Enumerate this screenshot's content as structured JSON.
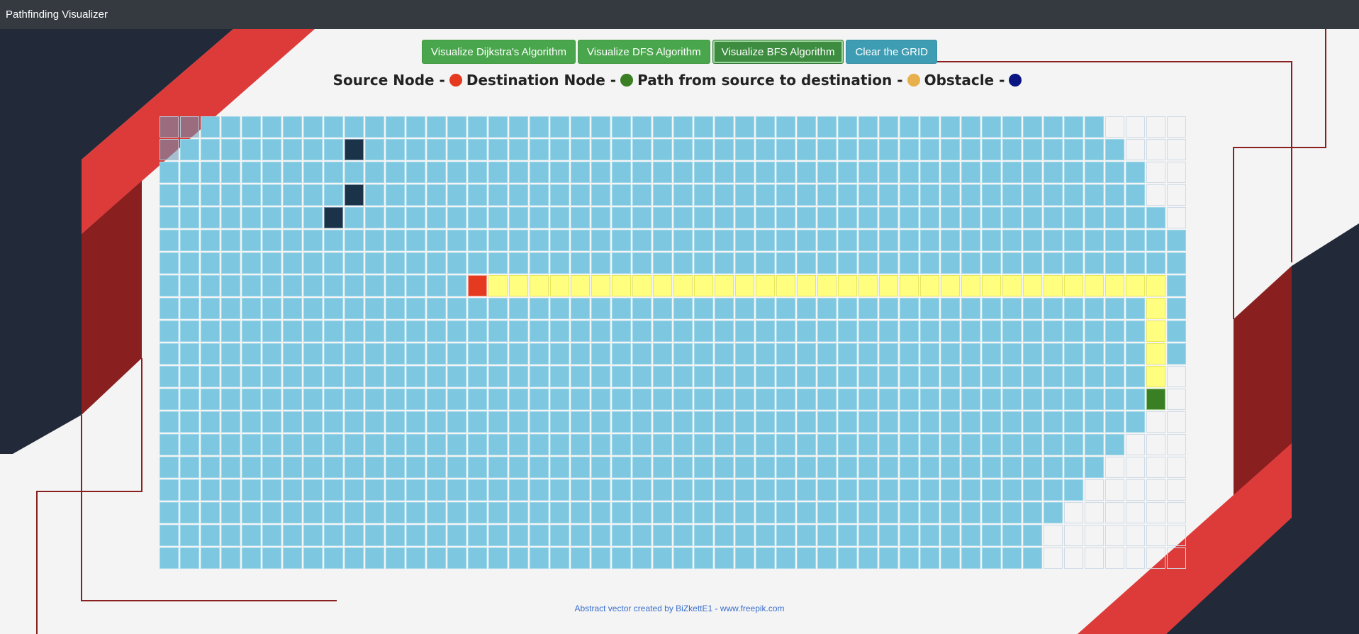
{
  "app": {
    "title": "Pathfinding Visualizer"
  },
  "toolbar": {
    "buttons": [
      {
        "label": "Visualize Dijkstra's Algorithm",
        "style": "green"
      },
      {
        "label": "Visualize DFS Algorithm",
        "style": "green"
      },
      {
        "label": "Visualize BFS Algorithm",
        "style": "active"
      },
      {
        "label": "Clear the GRID",
        "style": "info"
      }
    ]
  },
  "legend": [
    {
      "label": "Source Node -",
      "color": "#e53a1f"
    },
    {
      "label": "Destination Node -",
      "color": "#3a7f24"
    },
    {
      "label": "Path from source to destination -",
      "color": "#e8b04c"
    },
    {
      "label": "Obstacle -",
      "color": "#0b1683"
    }
  ],
  "grid": {
    "columns": 50,
    "rows": 20,
    "frontier": [
      46,
      47,
      48,
      48,
      49,
      50,
      50,
      50,
      50,
      50,
      50,
      49,
      48,
      48,
      47,
      46,
      45,
      44,
      43,
      43
    ],
    "walls": [
      [
        1,
        9
      ],
      [
        3,
        9
      ],
      [
        4,
        8
      ]
    ],
    "faded": [
      [
        0,
        0
      ],
      [
        0,
        1
      ],
      [
        1,
        0
      ]
    ],
    "start": [
      7,
      15
    ],
    "end": [
      12,
      48
    ],
    "path": [
      [
        7,
        16
      ],
      [
        7,
        17
      ],
      [
        7,
        18
      ],
      [
        7,
        19
      ],
      [
        7,
        20
      ],
      [
        7,
        21
      ],
      [
        7,
        22
      ],
      [
        7,
        23
      ],
      [
        7,
        24
      ],
      [
        7,
        25
      ],
      [
        7,
        26
      ],
      [
        7,
        27
      ],
      [
        7,
        28
      ],
      [
        7,
        29
      ],
      [
        7,
        30
      ],
      [
        7,
        31
      ],
      [
        7,
        32
      ],
      [
        7,
        33
      ],
      [
        7,
        34
      ],
      [
        7,
        35
      ],
      [
        7,
        36
      ],
      [
        7,
        37
      ],
      [
        7,
        38
      ],
      [
        7,
        39
      ],
      [
        7,
        40
      ],
      [
        7,
        41
      ],
      [
        7,
        42
      ],
      [
        7,
        43
      ],
      [
        7,
        44
      ],
      [
        7,
        45
      ],
      [
        7,
        46
      ],
      [
        7,
        47
      ],
      [
        7,
        48
      ],
      [
        8,
        48
      ],
      [
        9,
        48
      ],
      [
        10,
        48
      ],
      [
        11,
        48
      ]
    ],
    "colors": {
      "visited": "#7dc8e0",
      "wall": "#1b3348",
      "start": "#e53a1f",
      "end": "#3a7f24",
      "path": "#fffe7f"
    }
  },
  "footer": {
    "credit": "Abstract vector created by BiZkettE1 - www.freepik.com"
  }
}
